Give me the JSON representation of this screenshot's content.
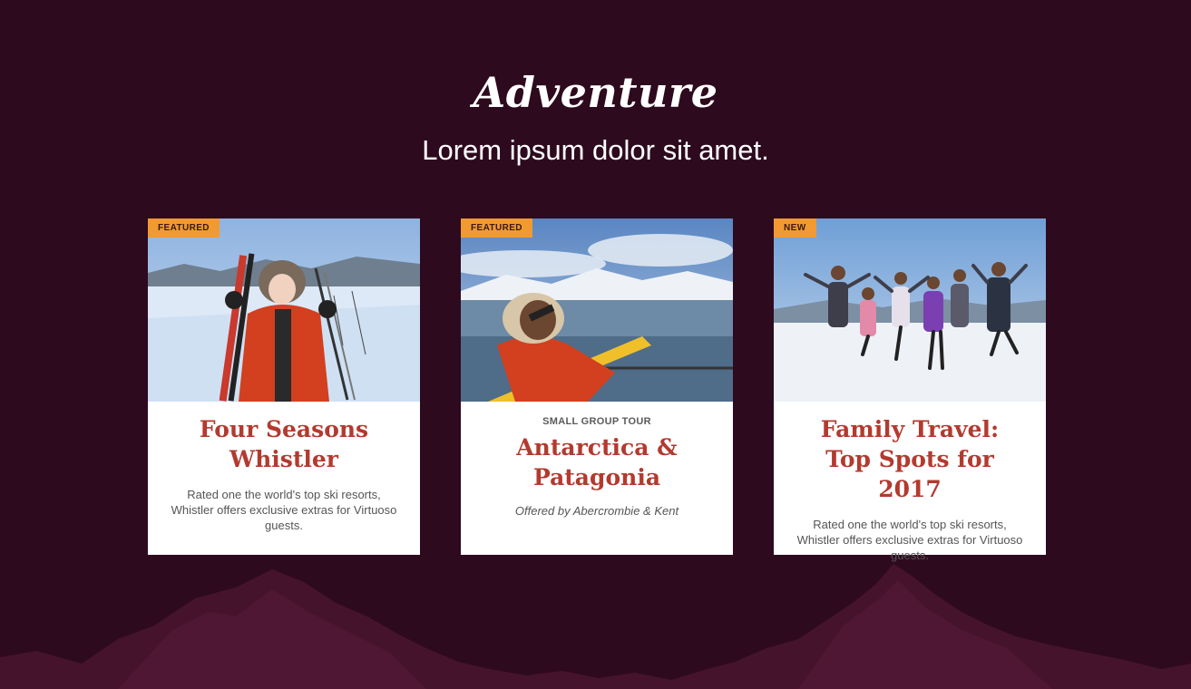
{
  "colors": {
    "background": "#2e0a1e",
    "mountain": "#4a1530",
    "badge": "#f29a32",
    "card_title": "#b33a2f"
  },
  "section": {
    "title": "Adventure",
    "subtitle": "Lorem ipsum dolor sit amet."
  },
  "cards": [
    {
      "badge": "FEATURED",
      "title_line1": "Four Seasons",
      "title_line2": "Whistler",
      "description": "Rated one the world's top ski resorts, Whistler offers exclusive extras for Virtuoso guests.",
      "image": "woman-skier-in-snow-photo"
    },
    {
      "badge": "FEATURED",
      "eyebrow": "SMALL GROUP TOUR",
      "title_line1": "Antarctica &",
      "title_line2": "Patagonia",
      "offered_by": "Offered by Abercrombie & Kent",
      "image": "kayaker-antarctica-photo"
    },
    {
      "badge": "NEW",
      "title_line1": "Family Travel:",
      "title_line2": "Top Spots for 2017",
      "description": "Rated one the world's top ski resorts, Whistler offers exclusive extras for Virtuoso guests.",
      "image": "family-jumping-in-snow-photo"
    }
  ]
}
